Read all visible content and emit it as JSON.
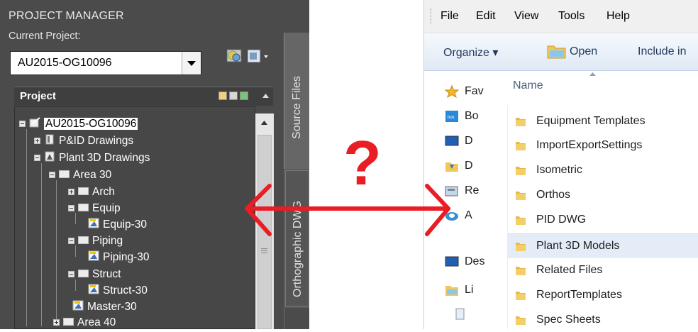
{
  "pm": {
    "title": "PROJECT MANAGER",
    "current_label": "Current Project:",
    "current_value": "AU2015-OG10096",
    "project_label": "Project",
    "tabs": [
      "Source Files",
      "Orthographic DWG"
    ],
    "tree": [
      {
        "label": "AU2015-OG10096"
      },
      {
        "label": "P&ID Drawings"
      },
      {
        "label": "Plant 3D Drawings"
      },
      {
        "label": "Area 30"
      },
      {
        "label": "Arch"
      },
      {
        "label": "Equip"
      },
      {
        "label": "Equip-30"
      },
      {
        "label": "Piping"
      },
      {
        "label": "Piping-30"
      },
      {
        "label": "Struct"
      },
      {
        "label": "Struct-30"
      },
      {
        "label": "Master-30"
      },
      {
        "label": "Area 40"
      }
    ]
  },
  "overlay": {
    "question": "?"
  },
  "explorer": {
    "menu": [
      "File",
      "Edit",
      "View",
      "Tools",
      "Help"
    ],
    "toolbar": {
      "organize": "Organize ▾",
      "open": "Open",
      "include": "Include in"
    },
    "nav": [
      "Fav",
      "Bo",
      "D",
      "D",
      "Re",
      "A",
      "Des",
      "Li"
    ],
    "column": "Name",
    "rows": [
      "Equipment Templates",
      "ImportExportSettings",
      "Isometric",
      "Orthos",
      "PID DWG",
      "Plant 3D Models",
      "Related Files",
      "ReportTemplates",
      "Spec Sheets"
    ]
  },
  "colors": {
    "accent_red": "#ea1c24",
    "folder_yellow": "#e8b847",
    "selected_row": "#e3ecf7"
  }
}
